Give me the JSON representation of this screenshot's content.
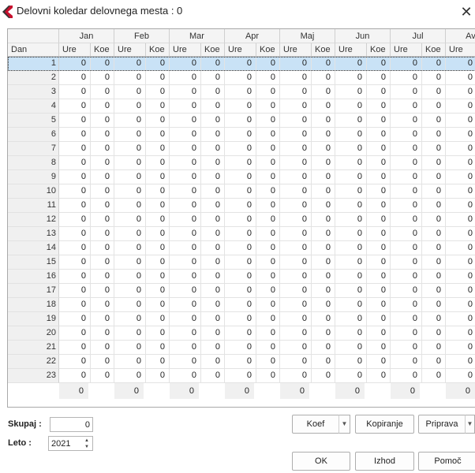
{
  "window": {
    "title": "Delovni koledar delovnega mesta : 0",
    "close_glyph": "✕"
  },
  "grid": {
    "row_header_label": "Dan",
    "months": [
      "Jan",
      "Feb",
      "Mar",
      "Apr",
      "Maj",
      "Jun",
      "Jul",
      "Avg"
    ],
    "subheaders": [
      "Ure",
      "Koe"
    ],
    "days": [
      "1",
      "2",
      "3",
      "4",
      "5",
      "6",
      "7",
      "8",
      "9",
      "10",
      "11",
      "12",
      "13",
      "14",
      "15",
      "16",
      "17",
      "18",
      "19",
      "20",
      "21",
      "22",
      "23"
    ],
    "cell_value": "0",
    "selected_row": 1,
    "totals": [
      "0",
      "0",
      "0",
      "0",
      "0",
      "0",
      "0",
      "0"
    ]
  },
  "form": {
    "skupaj_label": "Skupaj :",
    "skupaj_value": "0",
    "leto_label": "Leto :",
    "leto_value": "2021"
  },
  "buttons": {
    "koef": "Koef",
    "kopiranje": "Kopiranje",
    "priprava": "Priprava",
    "ok": "OK",
    "izhod": "Izhod",
    "pomoc": "Pomoč"
  },
  "icons": {
    "app": "app-logo-icon",
    "close": "close-icon",
    "dropdown": "chevron-down-icon",
    "spin": "spinner-arrows-icon"
  }
}
